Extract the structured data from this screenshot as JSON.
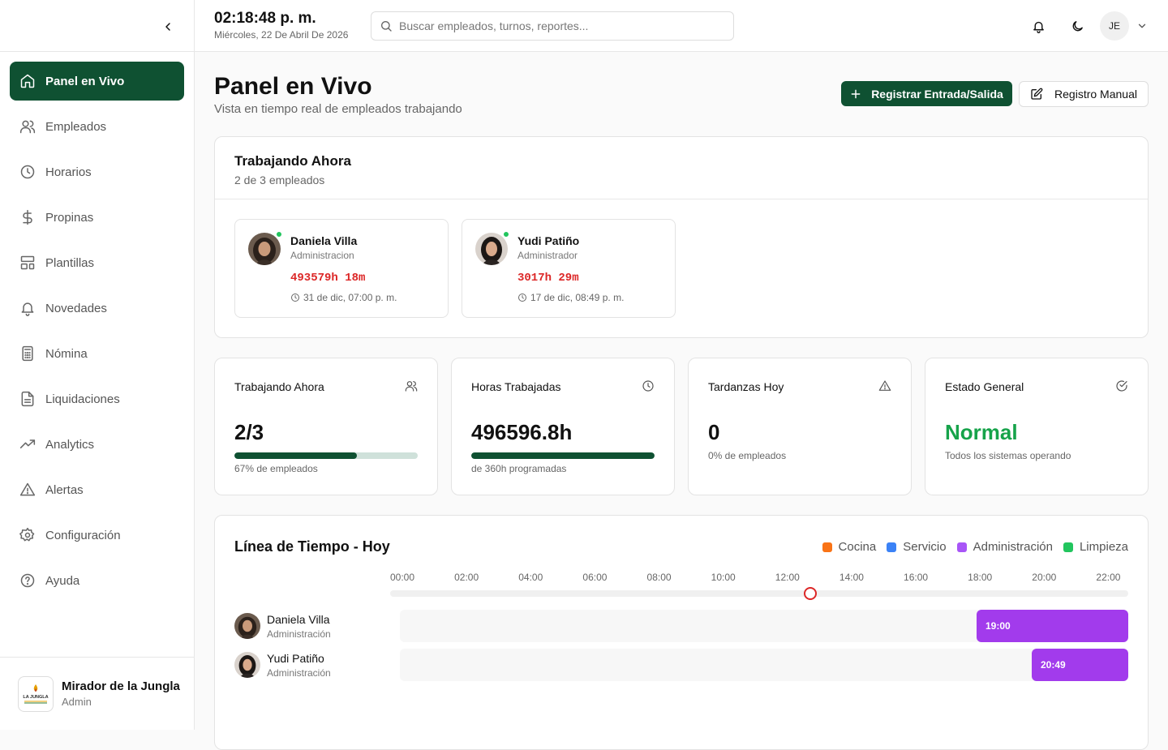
{
  "topbar": {
    "time": "02:18:48 p. m.",
    "date": "Miércoles, 22 De Abril De 2026",
    "search_placeholder": "Buscar empleados, turnos, reportes...",
    "user_initials": "JE"
  },
  "sidebar": {
    "items": [
      {
        "label": "Panel en Vivo",
        "icon": "home-icon",
        "active": true
      },
      {
        "label": "Empleados",
        "icon": "users-icon"
      },
      {
        "label": "Horarios",
        "icon": "clock-icon"
      },
      {
        "label": "Propinas",
        "icon": "dollar-icon"
      },
      {
        "label": "Plantillas",
        "icon": "layout-template-icon"
      },
      {
        "label": "Novedades",
        "icon": "bell-icon"
      },
      {
        "label": "Nómina",
        "icon": "calculator-icon"
      },
      {
        "label": "Liquidaciones",
        "icon": "file-text-icon"
      },
      {
        "label": "Analytics",
        "icon": "trending-up-icon"
      },
      {
        "label": "Alertas",
        "icon": "alert-triangle-icon"
      },
      {
        "label": "Configuración",
        "icon": "settings-icon"
      },
      {
        "label": "Ayuda",
        "icon": "help-circle-icon"
      }
    ],
    "org": {
      "name": "Mirador de la Jungla",
      "role": "Admin",
      "logo_text": "LA JUNGLA"
    }
  },
  "page": {
    "title": "Panel en Vivo",
    "subtitle": "Vista en tiempo real de empleados trabajando",
    "primary_button": "Registrar Entrada/Salida",
    "secondary_button": "Registro Manual"
  },
  "working_now": {
    "title": "Trabajando Ahora",
    "subtitle": "2 de 3 empleados",
    "employees": [
      {
        "name": "Daniela Villa",
        "role": "Administracion",
        "duration": "493579h 18m",
        "since": "31 de dic, 07:00 p. m."
      },
      {
        "name": "Yudi Patiño",
        "role": "Administrador",
        "duration": "3017h 29m",
        "since": "17 de dic, 08:49 p. m."
      }
    ]
  },
  "stats": [
    {
      "title": "Trabajando Ahora",
      "icon": "users-icon",
      "value": "2/3",
      "progress": 0.67,
      "footer": "67% de empleados",
      "color": "#111111"
    },
    {
      "title": "Horas Trabajadas",
      "icon": "clock-icon",
      "value": "496596.8h",
      "progress": 1.0,
      "footer": "de 360h programadas",
      "color": "#111111"
    },
    {
      "title": "Tardanzas Hoy",
      "icon": "alert-triangle-icon",
      "value": "0",
      "footer": "0% de empleados",
      "color": "#111111"
    },
    {
      "title": "Estado General",
      "icon": "check-circle-icon",
      "value": "Normal",
      "footer": "Todos los sistemas operando",
      "color": "#16a34a"
    }
  ],
  "timeline": {
    "title": "Línea de Tiempo - Hoy",
    "legend": [
      {
        "label": "Cocina",
        "color": "#f97316"
      },
      {
        "label": "Servicio",
        "color": "#3b82f6"
      },
      {
        "label": "Administración",
        "color": "#a855f7"
      },
      {
        "label": "Limpieza",
        "color": "#22c55e"
      }
    ],
    "hours": [
      "00:00",
      "02:00",
      "04:00",
      "06:00",
      "08:00",
      "10:00",
      "12:00",
      "14:00",
      "16:00",
      "18:00",
      "20:00",
      "22:00"
    ],
    "now_hour": 13.3,
    "rows": [
      {
        "name": "Daniela Villa",
        "role": "Administración",
        "start_label": "19:00",
        "start_hour": 19.0,
        "end_hour": 24.0,
        "color": "#a23bec"
      },
      {
        "name": "Yudi Patiño",
        "role": "Administración",
        "start_label": "20:49",
        "start_hour": 20.82,
        "end_hour": 24.0,
        "color": "#a23bec"
      }
    ]
  }
}
